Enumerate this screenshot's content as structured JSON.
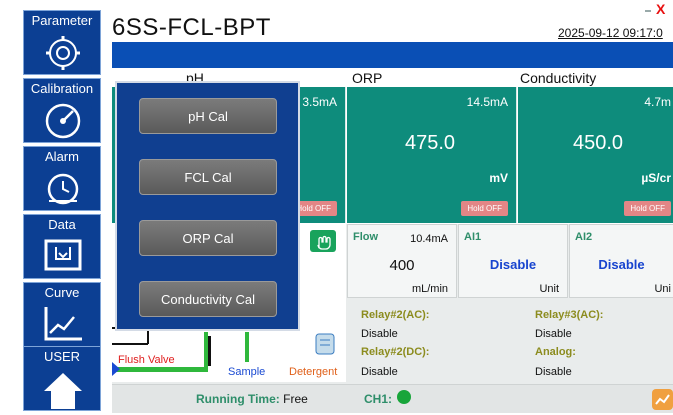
{
  "header": {
    "title": "6SS-FCL-BPT",
    "datetime": "2025-09-12 09:17:0",
    "close_glyph": "X"
  },
  "sections": {
    "ph": "pH",
    "orp": "ORP",
    "conductivity": "Conductivity"
  },
  "cards": [
    {
      "ma": "3.5mA",
      "value": "",
      "unit": "",
      "hold": "Hold OFF"
    },
    {
      "ma": "14.5mA",
      "value": "475.0",
      "unit": "mV",
      "hold": "Hold OFF"
    },
    {
      "ma": "4.7m",
      "value": "450.0",
      "unit": "µS/cr",
      "hold": "Hold OFF"
    }
  ],
  "flow": {
    "label": "Flow",
    "ma": "10.4mA",
    "value": "400",
    "unit": "mL/min"
  },
  "ai1": {
    "label": "AI1",
    "value": "Disable",
    "unit": "Unit"
  },
  "ai2": {
    "label": "AI2",
    "value": "Disable",
    "unit": "Uni"
  },
  "relays": {
    "relay2ac": {
      "label": "Relay#2(AC):",
      "value": "Disable"
    },
    "relay3ac": {
      "label": "Relay#3(AC):",
      "value": "Disable"
    },
    "relay2dc": {
      "label": "Relay#2(DC):",
      "value": "Disable"
    },
    "analog": {
      "label": "Analog:",
      "value": "Disable"
    }
  },
  "diagram": {
    "flush_valve": "Flush Valve",
    "sample": "Sample",
    "detergent": "Detergent",
    "partial_label": "w"
  },
  "status": {
    "running_label": "Running Time:",
    "running_value": "Free",
    "ch1_label": "CH1:"
  },
  "sidebar": {
    "items": [
      {
        "label": "Parameter",
        "icon": "gear-icon"
      },
      {
        "label": "Calibration",
        "icon": "gauge-icon"
      },
      {
        "label": "Alarm",
        "icon": "alarm-icon"
      },
      {
        "label": "Data",
        "icon": "data-icon"
      },
      {
        "label": "Curve",
        "icon": "curve-icon"
      },
      {
        "label": "USER",
        "icon": "home-icon"
      }
    ]
  },
  "popup": {
    "items": [
      {
        "label": "pH Cal"
      },
      {
        "label": "FCL Cal"
      },
      {
        "label": "ORP Cal"
      },
      {
        "label": "Conductivity Cal"
      }
    ]
  },
  "colors": {
    "header_bar": "#0a4fb5",
    "card_teal": "#0e8c7c",
    "sidebar_blue": "#0c3f93",
    "hold_pink": "#e38686",
    "disable_blue": "#1744cf",
    "label_green": "#2e8e6a",
    "relay_olive": "#8c8c1e"
  }
}
